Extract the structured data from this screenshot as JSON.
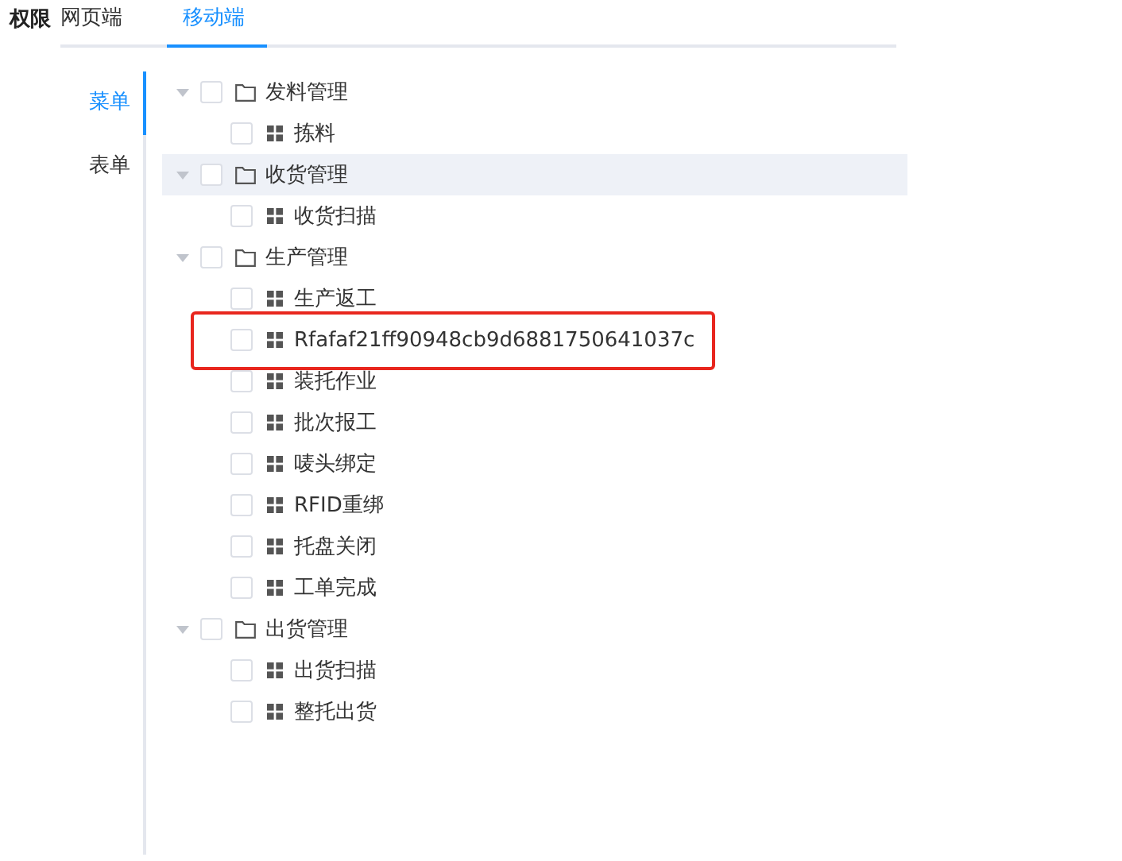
{
  "header": {
    "title": "权限",
    "tabs": [
      {
        "label": "网页端",
        "selected": false
      },
      {
        "label": "移动端",
        "selected": true
      }
    ]
  },
  "side_tabs": [
    {
      "label": "菜单",
      "selected": true
    },
    {
      "label": "表单",
      "selected": false
    }
  ],
  "tree": [
    {
      "label": "发料管理",
      "expanded": true,
      "checked": false,
      "hovered": false,
      "highlighted": false,
      "children": [
        {
          "label": "拣料",
          "checked": false,
          "hovered": false,
          "highlighted": false
        }
      ]
    },
    {
      "label": "收货管理",
      "expanded": true,
      "checked": false,
      "hovered": true,
      "highlighted": false,
      "children": [
        {
          "label": "收货扫描",
          "checked": false,
          "hovered": false,
          "highlighted": false
        }
      ]
    },
    {
      "label": "生产管理",
      "expanded": true,
      "checked": false,
      "hovered": false,
      "highlighted": false,
      "children": [
        {
          "label": "生产返工",
          "checked": false,
          "hovered": false,
          "highlighted": false
        },
        {
          "label": "Rfafaf21ff90948cb9d6881750641037c",
          "checked": false,
          "hovered": false,
          "highlighted": true
        },
        {
          "label": "装托作业",
          "checked": false,
          "hovered": false,
          "highlighted": false
        },
        {
          "label": "批次报工",
          "checked": false,
          "hovered": false,
          "highlighted": false
        },
        {
          "label": "唛头绑定",
          "checked": false,
          "hovered": false,
          "highlighted": false
        },
        {
          "label": "RFID重绑",
          "checked": false,
          "hovered": false,
          "highlighted": false
        },
        {
          "label": "托盘关闭",
          "checked": false,
          "hovered": false,
          "highlighted": false
        },
        {
          "label": "工单完成",
          "checked": false,
          "hovered": false,
          "highlighted": false
        }
      ]
    },
    {
      "label": "出货管理",
      "expanded": true,
      "checked": false,
      "hovered": false,
      "highlighted": false,
      "children": [
        {
          "label": "出货扫描",
          "checked": false,
          "hovered": false,
          "highlighted": false
        },
        {
          "label": "整托出货",
          "checked": false,
          "hovered": false,
          "highlighted": false
        }
      ]
    }
  ]
}
